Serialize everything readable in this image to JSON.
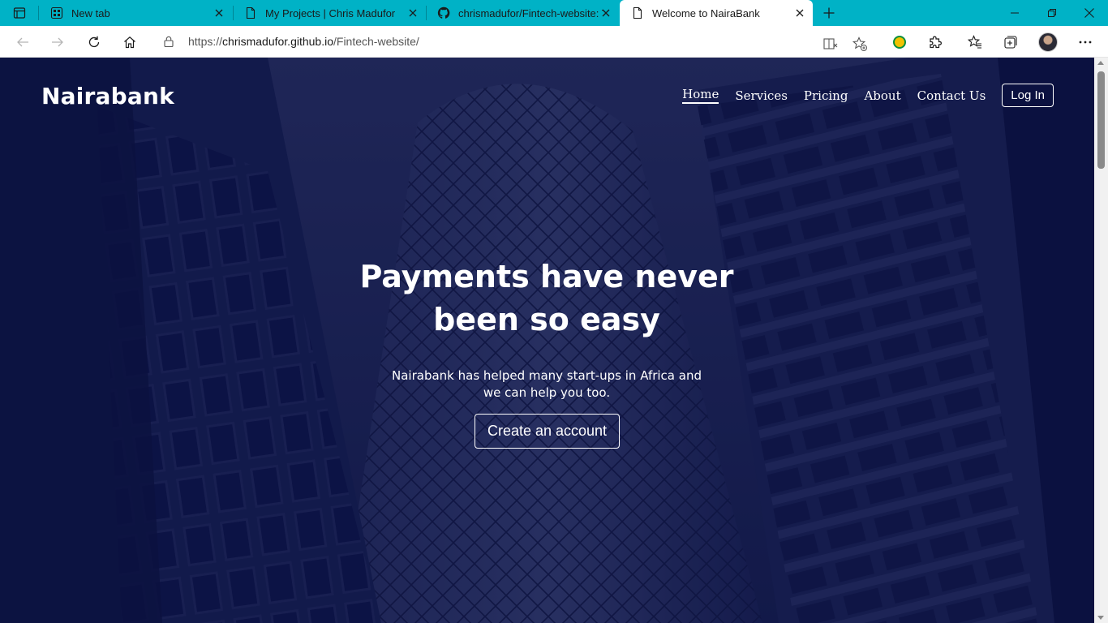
{
  "browser": {
    "tabs": [
      {
        "title": "New tab",
        "icon": "newtab-page-icon",
        "active": false
      },
      {
        "title": "My Projects | Chris Madufor",
        "icon": "page-icon",
        "active": false
      },
      {
        "title": "chrismadufor/Fintech-website: Th",
        "icon": "github-icon",
        "active": false
      },
      {
        "title": "Welcome to NairaBank",
        "icon": "page-icon",
        "active": true
      }
    ],
    "url": {
      "scheme": "https://",
      "host": "chrismadufor.github.io",
      "path": "/Fintech-website/"
    },
    "accent": "#00b2c6"
  },
  "site": {
    "brand": "Nairabank",
    "nav": {
      "home": "Home",
      "services": "Services",
      "pricing": "Pricing",
      "about": "About",
      "contact": "Contact Us",
      "login": "Log In"
    },
    "hero": {
      "title_line1": "Payments have never",
      "title_line2": "been so easy",
      "subtitle_line1": "Nairabank has helped many start-ups in Africa and",
      "subtitle_line2": "we can help you too.",
      "cta": "Create an account"
    },
    "colors": {
      "hero_bg": "#0c1240",
      "text": "#ffffff"
    }
  }
}
